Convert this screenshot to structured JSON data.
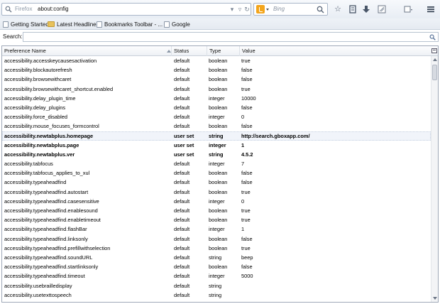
{
  "toolbar": {
    "identity": "Firefox",
    "url": "about:config",
    "search_placeholder": "Bing"
  },
  "bookmarks": [
    {
      "label": "Getting Started",
      "icon": "page-icon"
    },
    {
      "label": "Latest Headlines",
      "icon": "folder-icon"
    },
    {
      "label": "Bookmarks Toolbar - ...",
      "icon": "page-icon"
    },
    {
      "label": "Google",
      "icon": "page-icon"
    }
  ],
  "filter": {
    "label": "Search:",
    "value": ""
  },
  "table": {
    "headers": {
      "name": "Preference Name",
      "status": "Status",
      "type": "Type",
      "value": "Value"
    },
    "rows": [
      {
        "name": "accessibility.accesskeycausesactivation",
        "status": "default",
        "type": "boolean",
        "value": "true"
      },
      {
        "name": "accessibility.blockautorefresh",
        "status": "default",
        "type": "boolean",
        "value": "false"
      },
      {
        "name": "accessibility.browsewithcaret",
        "status": "default",
        "type": "boolean",
        "value": "false"
      },
      {
        "name": "accessibility.browsewithcaret_shortcut.enabled",
        "status": "default",
        "type": "boolean",
        "value": "true"
      },
      {
        "name": "accessibility.delay_plugin_time",
        "status": "default",
        "type": "integer",
        "value": "10000"
      },
      {
        "name": "accessibility.delay_plugins",
        "status": "default",
        "type": "boolean",
        "value": "false"
      },
      {
        "name": "accessibility.force_disabled",
        "status": "default",
        "type": "integer",
        "value": "0"
      },
      {
        "name": "accessibility.mouse_focuses_formcontrol",
        "status": "default",
        "type": "boolean",
        "value": "false"
      },
      {
        "name": "accessibility.newtabplus.homepage",
        "status": "user set",
        "type": "string",
        "value": "http://search.gboxapp.com/",
        "userset": true,
        "selected": true
      },
      {
        "name": "accessibility.newtabplus.page",
        "status": "user set",
        "type": "integer",
        "value": "1",
        "userset": true
      },
      {
        "name": "accessibility.newtabplus.ver",
        "status": "user set",
        "type": "string",
        "value": "4.5.2",
        "userset": true
      },
      {
        "name": "accessibility.tabfocus",
        "status": "default",
        "type": "integer",
        "value": "7"
      },
      {
        "name": "accessibility.tabfocus_applies_to_xul",
        "status": "default",
        "type": "boolean",
        "value": "false"
      },
      {
        "name": "accessibility.typeaheadfind",
        "status": "default",
        "type": "boolean",
        "value": "false"
      },
      {
        "name": "accessibility.typeaheadfind.autostart",
        "status": "default",
        "type": "boolean",
        "value": "true"
      },
      {
        "name": "accessibility.typeaheadfind.casesensitive",
        "status": "default",
        "type": "integer",
        "value": "0"
      },
      {
        "name": "accessibility.typeaheadfind.enablesound",
        "status": "default",
        "type": "boolean",
        "value": "true"
      },
      {
        "name": "accessibility.typeaheadfind.enabletimeout",
        "status": "default",
        "type": "boolean",
        "value": "true"
      },
      {
        "name": "accessibility.typeaheadfind.flashBar",
        "status": "default",
        "type": "integer",
        "value": "1"
      },
      {
        "name": "accessibility.typeaheadfind.linksonly",
        "status": "default",
        "type": "boolean",
        "value": "false"
      },
      {
        "name": "accessibility.typeaheadfind.prefillwithselection",
        "status": "default",
        "type": "boolean",
        "value": "true"
      },
      {
        "name": "accessibility.typeaheadfind.soundURL",
        "status": "default",
        "type": "string",
        "value": "beep"
      },
      {
        "name": "accessibility.typeaheadfind.startlinksonly",
        "status": "default",
        "type": "boolean",
        "value": "false"
      },
      {
        "name": "accessibility.typeaheadfind.timeout",
        "status": "default",
        "type": "integer",
        "value": "5000"
      },
      {
        "name": "accessibility.usebrailledisplay",
        "status": "default",
        "type": "string",
        "value": ""
      },
      {
        "name": "accessibility.usetexttospeech",
        "status": "default",
        "type": "string",
        "value": ""
      }
    ]
  }
}
